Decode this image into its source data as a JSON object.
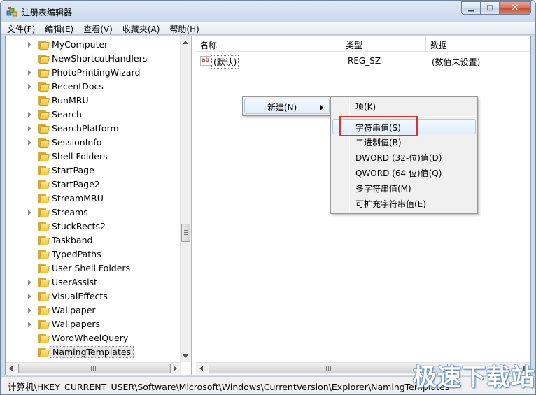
{
  "window": {
    "title": "注册表编辑器"
  },
  "menu": [
    "文件(F)",
    "编辑(E)",
    "查看(V)",
    "收藏夹(A)",
    "帮助(H)"
  ],
  "tree": {
    "items": [
      {
        "label": "MyComputer",
        "expandable": true
      },
      {
        "label": "NewShortcutHandlers",
        "expandable": false
      },
      {
        "label": "PhotoPrintingWizard",
        "expandable": true
      },
      {
        "label": "RecentDocs",
        "expandable": true
      },
      {
        "label": "RunMRU",
        "expandable": false
      },
      {
        "label": "Search",
        "expandable": true
      },
      {
        "label": "SearchPlatform",
        "expandable": true
      },
      {
        "label": "SessionInfo",
        "expandable": true
      },
      {
        "label": "Shell Folders",
        "expandable": false
      },
      {
        "label": "StartPage",
        "expandable": false
      },
      {
        "label": "StartPage2",
        "expandable": false
      },
      {
        "label": "StreamMRU",
        "expandable": false
      },
      {
        "label": "Streams",
        "expandable": true
      },
      {
        "label": "StuckRects2",
        "expandable": false
      },
      {
        "label": "Taskband",
        "expandable": false
      },
      {
        "label": "TypedPaths",
        "expandable": false
      },
      {
        "label": "User Shell Folders",
        "expandable": false
      },
      {
        "label": "UserAssist",
        "expandable": true
      },
      {
        "label": "VisualEffects",
        "expandable": true
      },
      {
        "label": "Wallpaper",
        "expandable": true
      },
      {
        "label": "Wallpapers",
        "expandable": true
      },
      {
        "label": "WordWheelQuery",
        "expandable": false
      },
      {
        "label": "NamingTemplates",
        "expandable": false,
        "selected": true
      }
    ]
  },
  "list": {
    "columns": [
      "名称",
      "类型",
      "数据"
    ],
    "rows": [
      {
        "name": "(默认)",
        "type": "REG_SZ",
        "data": "(数值未设置)"
      }
    ],
    "value_icon_text": "ab"
  },
  "context_menu": {
    "new_label": "新建(N)"
  },
  "submenu": {
    "items": [
      "项(K)",
      "字符串值(S)",
      "二进制值(B)",
      "DWORD (32-位)值(D)",
      "QWORD (64 位)值(Q)",
      "多字符串值(M)",
      "可扩充字符串值(E)"
    ],
    "highlighted": "字符串值(S)"
  },
  "statusbar": {
    "path": "计算机\\HKEY_CURRENT_USER\\Software\\Microsoft\\Windows\\CurrentVersion\\Explorer\\NamingTemplates"
  },
  "watermark": "极速下载站",
  "colors": {
    "highlight_box": "#d9342b",
    "folder": "#f2c53f"
  }
}
